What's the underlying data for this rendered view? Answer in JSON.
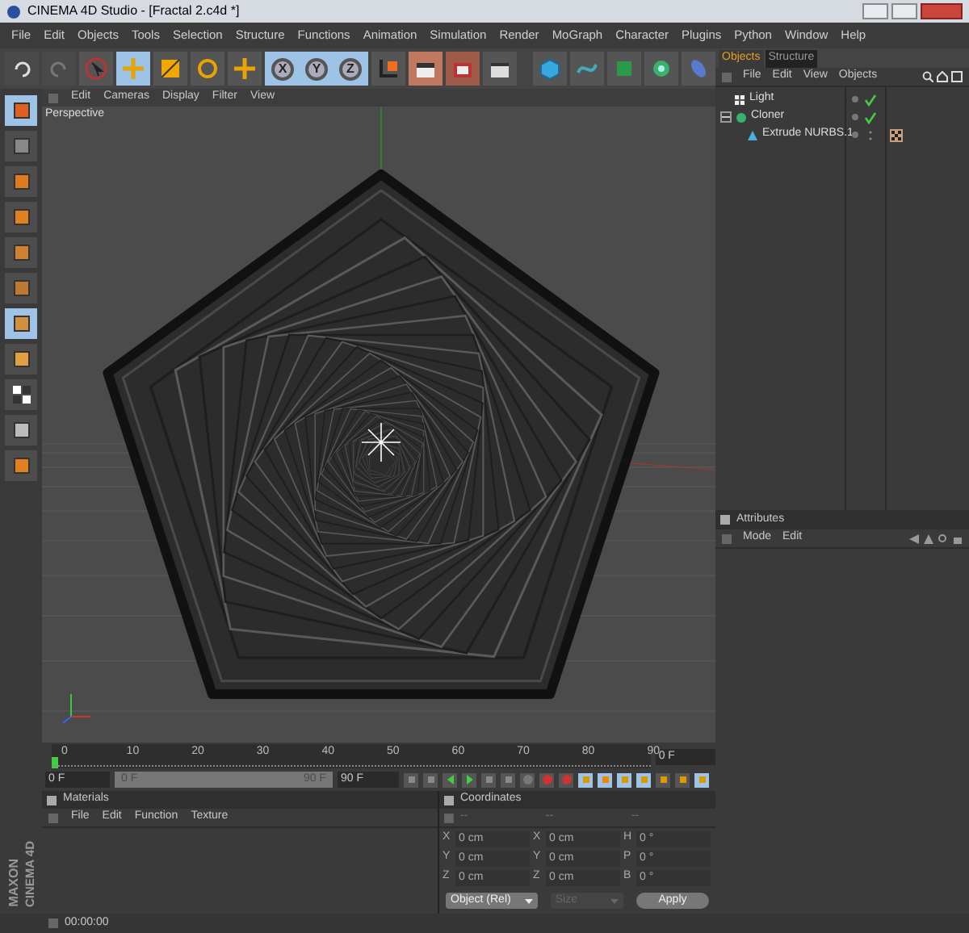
{
  "window": {
    "title": "CINEMA 4D Studio - [Fractal 2.c4d *]"
  },
  "menu_bar": [
    "File",
    "Edit",
    "Objects",
    "Tools",
    "Selection",
    "Structure",
    "Functions",
    "Animation",
    "Simulation",
    "Render",
    "MoGraph",
    "Character",
    "Plugins",
    "Python",
    "Window",
    "Help"
  ],
  "axis_buttons": [
    {
      "label": "X",
      "on": true
    },
    {
      "label": "Y",
      "on": true
    },
    {
      "label": "Z",
      "on": true
    }
  ],
  "viewport": {
    "menu": [
      "Edit",
      "Cameras",
      "Display",
      "Filter",
      "View"
    ],
    "label": "Perspective"
  },
  "objects_panel": {
    "tabs": [
      {
        "label": "Objects",
        "selected": true
      },
      {
        "label": "Structure",
        "selected": false
      }
    ],
    "menu": [
      "File",
      "Edit",
      "View",
      "Objects"
    ],
    "tree": [
      {
        "name": "Light",
        "checked": true
      },
      {
        "name": "Cloner",
        "checked": true,
        "expanded": true,
        "children": [
          {
            "name": "Extrude NURBS.1",
            "checked": false
          }
        ]
      }
    ]
  },
  "attributes_panel": {
    "title": "Attributes",
    "menu": [
      "Mode",
      "Edit"
    ]
  },
  "timeline": {
    "ticks": [
      "0",
      "10",
      "20",
      "30",
      "40",
      "50",
      "60",
      "70",
      "80",
      "90"
    ],
    "current_frame": "0 F",
    "start": "0 F",
    "range": {
      "start": "0 F",
      "end": "90 F",
      "level": 1
    },
    "end": "90 F"
  },
  "materials_panel": {
    "title": "Materials",
    "menu": [
      "File",
      "Edit",
      "Function",
      "Texture"
    ]
  },
  "coordinates_panel": {
    "title": "Coordinates",
    "headers": [
      "--",
      "--",
      "--"
    ],
    "rows": [
      {
        "cells": [
          {
            "axis": "X",
            "value": "0 cm"
          },
          {
            "axis": "X",
            "value": "0 cm"
          },
          {
            "axis": "H",
            "value": "0 °"
          }
        ]
      },
      {
        "cells": [
          {
            "axis": "Y",
            "value": "0 cm"
          },
          {
            "axis": "Y",
            "value": "0 cm"
          },
          {
            "axis": "P",
            "value": "0 °"
          }
        ]
      },
      {
        "cells": [
          {
            "axis": "Z",
            "value": "0 cm"
          },
          {
            "axis": "Z",
            "value": "0 cm"
          },
          {
            "axis": "B",
            "value": "0 °"
          }
        ]
      }
    ],
    "mode_dropdown": {
      "value": "Object (Rel)",
      "disabled": false
    },
    "size_dropdown": {
      "value": "Size",
      "disabled": true
    },
    "apply_button": "Apply"
  },
  "logo": [
    "MAXON",
    "CINEMA 4D"
  ],
  "status_bar": {
    "time": "00:00:00"
  }
}
